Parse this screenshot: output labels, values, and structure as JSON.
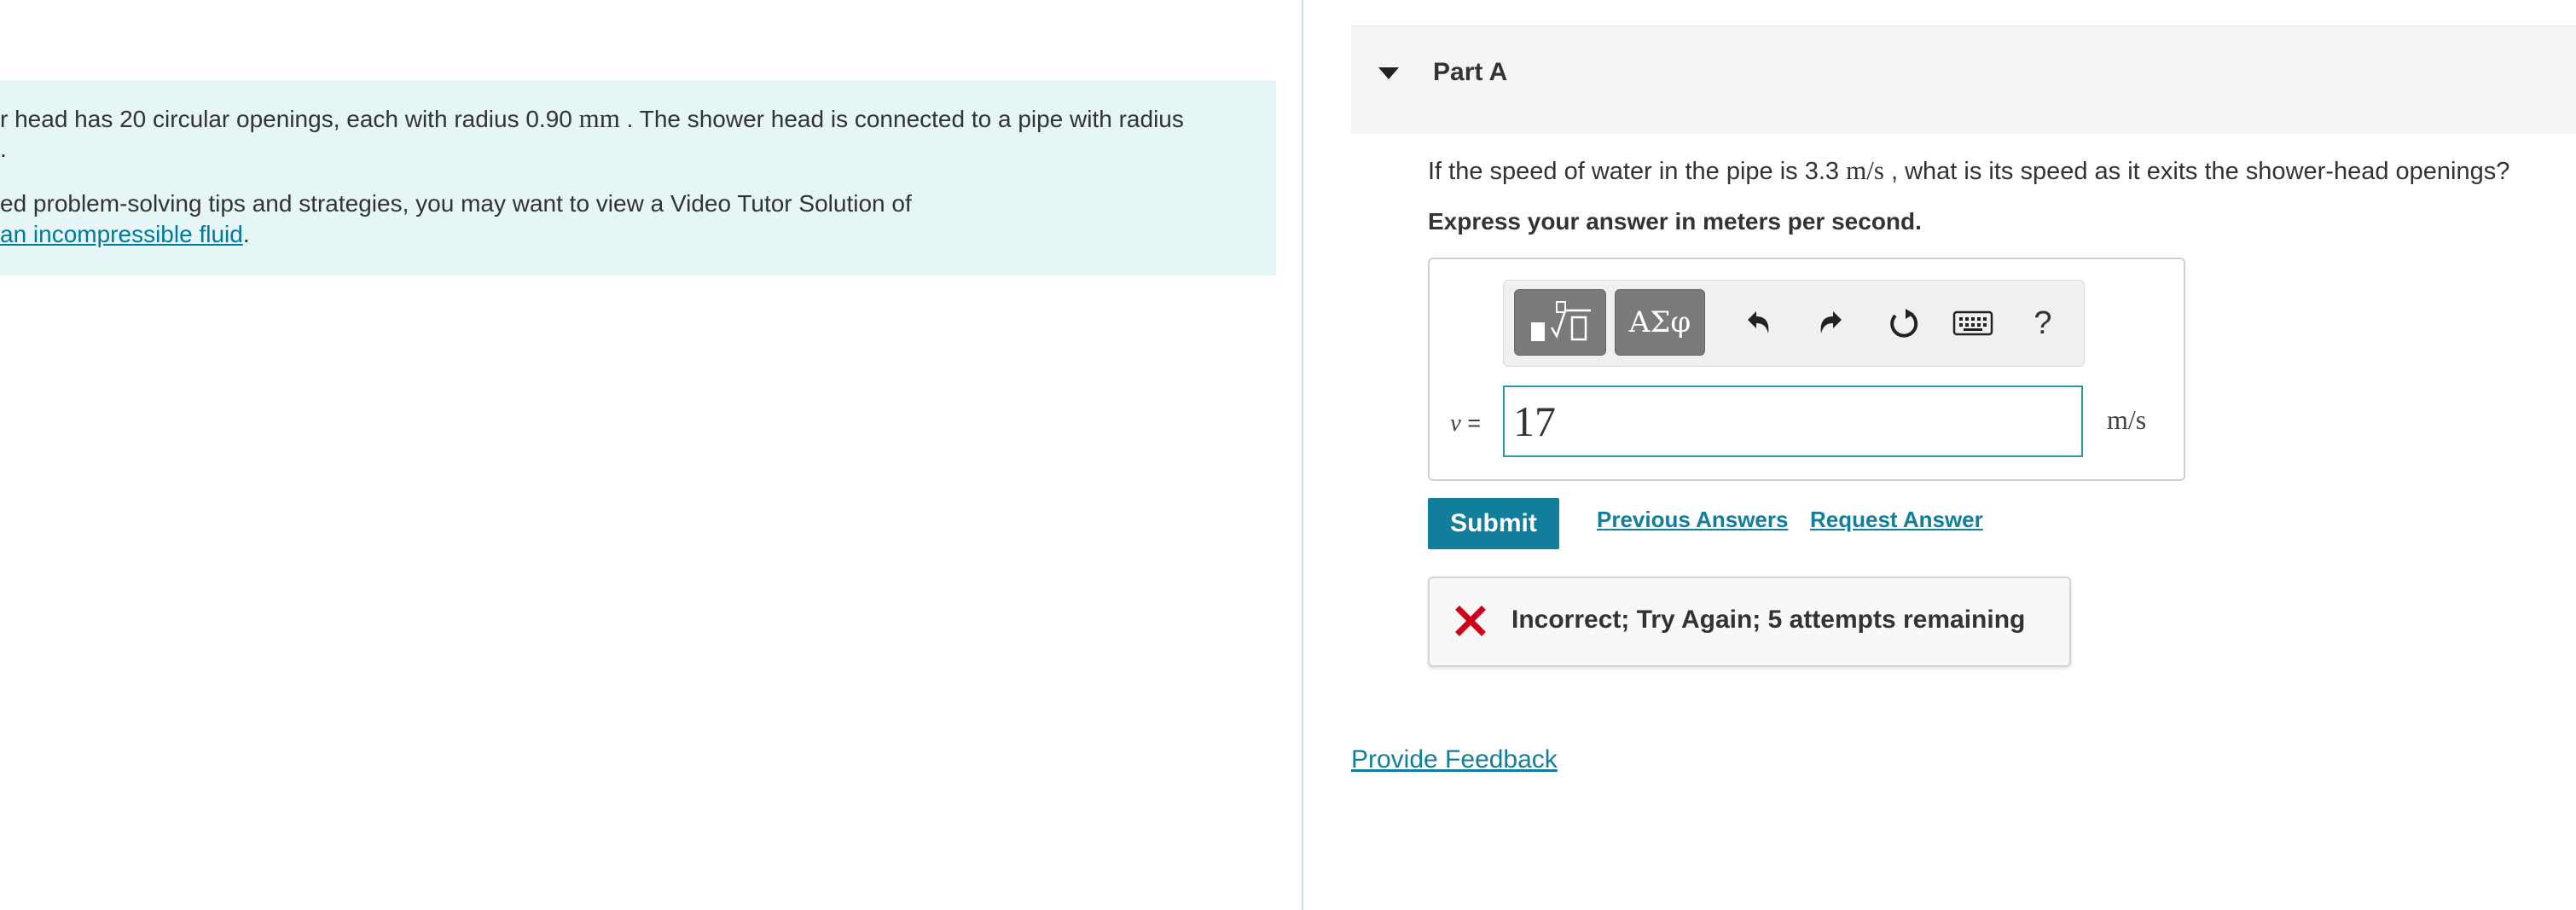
{
  "problem": {
    "line1_pre": "r head has 20 circular openings, each with radius 0.90",
    "line1_unit": "mm",
    "line1_post": ". The shower head is connected to a pipe with radius",
    "line2": ".",
    "tip_line1": "ed problem-solving tips and strategies, you may want to view a Video Tutor Solution of",
    "tip_link": "an incompressible fluid",
    "tip_end": "."
  },
  "part": {
    "title": "Part A",
    "question_pre": "If the speed of water in the pipe is 3.3",
    "question_unit": "m/s",
    "question_post": ", what is its speed as it exits the shower-head openings?",
    "instruction": "Express your answer in meters per second."
  },
  "toolbar": {
    "greek_label": "ΑΣφ",
    "help_label": "?",
    "icons": [
      "templates-icon",
      "greek-symbols-icon",
      "undo-icon",
      "redo-icon",
      "reset-icon",
      "keyboard-icon",
      "help-icon"
    ]
  },
  "answer": {
    "variable": "v",
    "equals": "=",
    "value": "17",
    "unit": "m/s"
  },
  "actions": {
    "submit": "Submit",
    "previous_answers": "Previous Answers",
    "request_answer": "Request Answer"
  },
  "feedback": {
    "message": "Incorrect; Try Again; 5 attempts remaining"
  },
  "footer": {
    "provide_feedback": "Provide Feedback"
  },
  "colors": {
    "accent": "#117f9c",
    "intro_bg": "#e6f5f5",
    "error": "#d0021b",
    "input_border": "#2a9aaa"
  }
}
